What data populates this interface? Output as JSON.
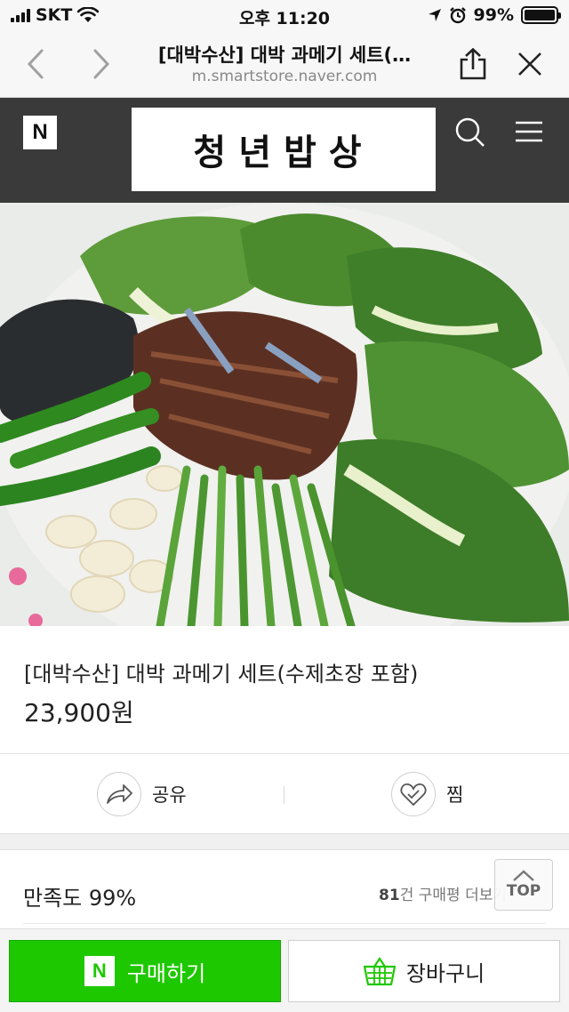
{
  "status_bar": {
    "carrier": "SKT",
    "time": "오후 11:20",
    "battery": "99%",
    "battery_level": 0.99
  },
  "browser": {
    "title": "[대박수산] 대박 과메기 세트(…",
    "url": "m.smartstore.naver.com"
  },
  "store": {
    "logo_letter": "N",
    "name": "청년밥상"
  },
  "product": {
    "name": "[대박수산] 대박 과메기 세트(수제초장 포함)",
    "price": "23,900원"
  },
  "actions": {
    "share_label": "공유",
    "wish_label": "찜"
  },
  "satisfaction": {
    "label": "만족도 99%",
    "review_count": "81",
    "review_suffix": "건 구매평 더보기"
  },
  "top_button": {
    "label": "TOP"
  },
  "purchase": {
    "buy_logo": "N",
    "buy_label": "구매하기",
    "cart_label": "장바구니"
  },
  "colors": {
    "naver_green": "#1ec800",
    "header_bg": "#3a3a3a"
  },
  "icons": [
    "back-icon",
    "forward-icon",
    "share-icon",
    "close-icon",
    "search-icon",
    "menu-icon",
    "share-arrow-icon",
    "heart-icon",
    "chevron-up-icon",
    "basket-icon"
  ]
}
